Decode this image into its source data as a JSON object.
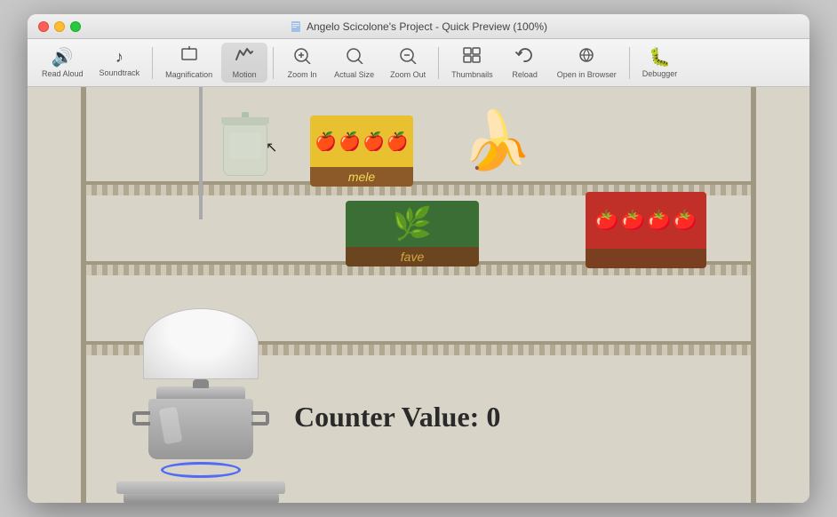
{
  "window": {
    "title": "Angelo Scicolone's Project - Quick Preview (100%)",
    "traffic_lights": {
      "close": "close",
      "minimize": "minimize",
      "maximize": "maximize"
    }
  },
  "toolbar": {
    "items": [
      {
        "id": "read-aloud",
        "label": "Read Aloud",
        "icon": "🔊"
      },
      {
        "id": "soundtrack",
        "label": "Soundtrack",
        "icon": "♪"
      },
      {
        "id": "magnification",
        "label": "Magnification",
        "icon": "⊡"
      },
      {
        "id": "motion",
        "label": "Motion",
        "icon": "〜"
      },
      {
        "id": "zoom-in",
        "label": "Zoom In",
        "icon": "+◎"
      },
      {
        "id": "actual-size",
        "label": "Actual Size",
        "icon": "◎"
      },
      {
        "id": "zoom-out",
        "label": "Zoom Out",
        "icon": "-◎"
      },
      {
        "id": "thumbnails",
        "label": "Thumbnails",
        "icon": "⊞"
      },
      {
        "id": "reload",
        "label": "Reload",
        "icon": "↻"
      },
      {
        "id": "open-in-browser",
        "label": "Open in Browser",
        "icon": "⊙"
      },
      {
        "id": "debugger",
        "label": "Debugger",
        "icon": "🐛"
      }
    ]
  },
  "scene": {
    "counter_label": "Counter Value: 0",
    "apple_box_label": "mele",
    "beans_box_label": "fave"
  }
}
